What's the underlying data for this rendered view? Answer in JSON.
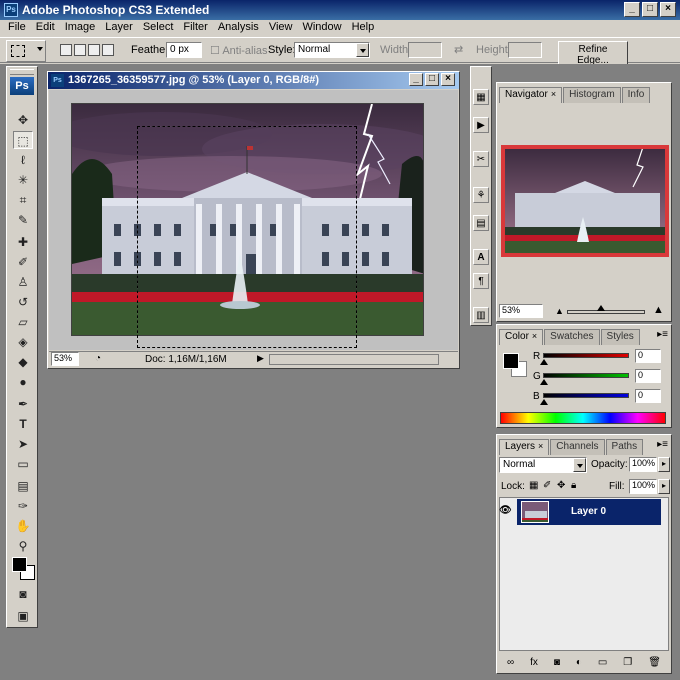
{
  "app": {
    "title": "Adobe Photoshop CS3 Extended",
    "logo": "Ps"
  },
  "menu": [
    "File",
    "Edit",
    "Image",
    "Layer",
    "Select",
    "Filter",
    "Analysis",
    "View",
    "Window",
    "Help"
  ],
  "options": {
    "feather_label": "Feather:",
    "feather_value": "0 px",
    "antialias_label": "Anti-alias",
    "style_label": "Style:",
    "style_value": "Normal",
    "width_label": "Width:",
    "height_label": "Height:",
    "refine_label": "Refine Edge..."
  },
  "document": {
    "title": "1367265_36359577.jpg @ 53% (Layer 0, RGB/8#)",
    "zoom": "53%",
    "doc_info": "Doc: 1,16M/1,16M"
  },
  "navigator": {
    "tabs": [
      "Navigator",
      "Histogram",
      "Info"
    ],
    "zoom": "53%"
  },
  "color": {
    "tabs": [
      "Color",
      "Swatches",
      "Styles"
    ],
    "r_label": "R",
    "g_label": "G",
    "b_label": "B",
    "r_value": "0",
    "g_value": "0",
    "b_value": "0",
    "r_color": "#c00000",
    "g_color": "#00a000",
    "b_color": "#0000c0"
  },
  "layers": {
    "tabs": [
      "Layers",
      "Channels",
      "Paths"
    ],
    "blend_mode": "Normal",
    "opacity_label": "Opacity:",
    "opacity_value": "100%",
    "lock_label": "Lock:",
    "fill_label": "Fill:",
    "fill_value": "100%",
    "layer_name": "Layer 0"
  },
  "colors": {
    "title_bar": "#0a246a",
    "chrome": "#d4d0c8",
    "workspace": "#808080",
    "selected_layer": "#0a246a"
  }
}
